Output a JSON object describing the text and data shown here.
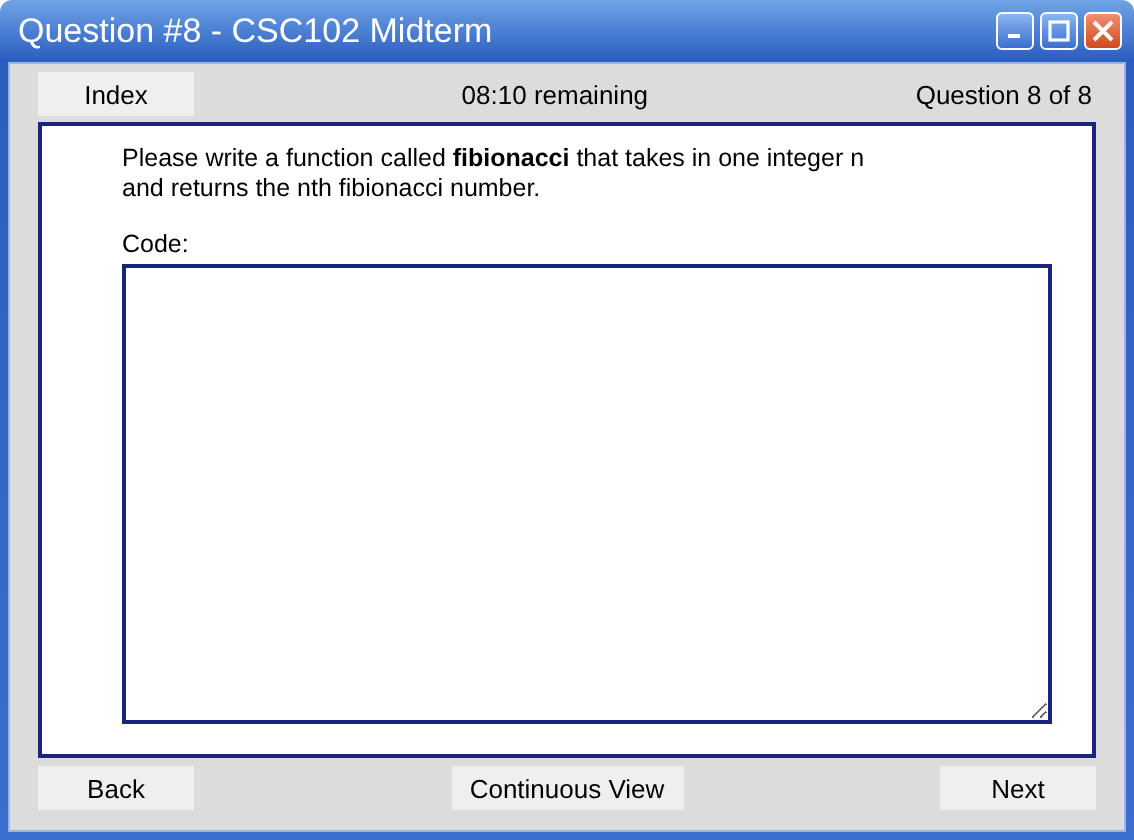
{
  "window": {
    "title": "Question #8 - CSC102 Midterm"
  },
  "top_bar": {
    "index_button": "Index",
    "timer": "08:10 remaining",
    "progress": "Question 8 of 8"
  },
  "question": {
    "prompt": "Please write a function called **fibionacci** that takes in one integer n and returns the nth fibionacci number.",
    "code_label": "Code:"
  },
  "bottom_bar": {
    "back_button": "Back",
    "view_button": "Continuous View",
    "next_button": "Next"
  }
}
